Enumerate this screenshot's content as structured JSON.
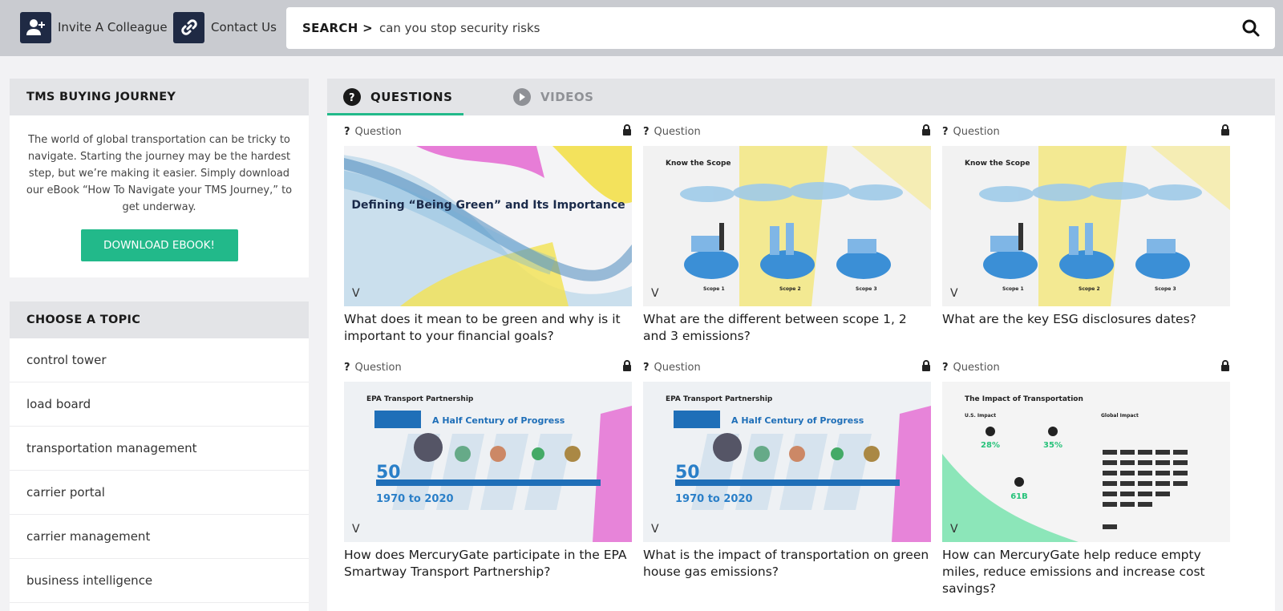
{
  "topbar": {
    "invite_label": "Invite A Colleague",
    "contact_label": "Contact Us",
    "search_prefix": "SEARCH >",
    "search_value": "can you stop security risks"
  },
  "sidebar": {
    "journey": {
      "title": "TMS BUYING JOURNEY",
      "text": "The world of global transportation can be tricky to navigate. Starting the journey may be the hardest step, but we’re making it easier. Simply download our eBook “How To Navigate your TMS Journey,” to get underway.",
      "button": "DOWNLOAD EBOOK!"
    },
    "topics_title": "CHOOSE A TOPIC",
    "topics": [
      "control tower",
      "load board",
      "transportation management",
      "carrier portal",
      "carrier management",
      "business intelligence"
    ]
  },
  "tabs": [
    {
      "label": "QUESTIONS",
      "active": true
    },
    {
      "label": "VIDEOS",
      "active": false
    }
  ],
  "colors": {
    "accent": "#22b98a",
    "navy": "#1f2a44"
  },
  "cards": [
    {
      "tag": "Question",
      "thumb": "green",
      "title": "What does it mean to be green and why is it important to your financial goals?",
      "thumb_text": "Defining “Being Green” and Its Importance"
    },
    {
      "tag": "Question",
      "thumb": "scope",
      "title": "What are the different between scope 1, 2 and 3 emissions?",
      "thumb_text": "Know the Scope",
      "scope_labels": [
        "Scope 1",
        "Scope 2",
        "Scope 3"
      ]
    },
    {
      "tag": "Question",
      "thumb": "scope",
      "title": "What are the key ESG disclosures dates?",
      "thumb_text": "Know the Scope",
      "scope_labels": [
        "Scope 1",
        "Scope 2",
        "Scope 3"
      ]
    },
    {
      "tag": "Question",
      "thumb": "epa",
      "title": "How does MercuryGate participate in the EPA Smartway Transport Partnership?",
      "thumb_text": "EPA Transport Partnership",
      "thumb_sub": "A Half Century of Progress",
      "years": "1970 to 2020"
    },
    {
      "tag": "Question",
      "thumb": "epa",
      "title": "What is the impact of transportation on green house gas emissions?",
      "thumb_text": "EPA Transport Partnership",
      "thumb_sub": "A Half Century of Progress",
      "years": "1970 to 2020"
    },
    {
      "tag": "Question",
      "thumb": "impact",
      "title": "How can MercuryGate help reduce empty miles, reduce emissions and increase cost savings?",
      "thumb_text": "The Impact of Transportation",
      "stats": [
        "28%",
        "35%",
        "61B"
      ],
      "headers": [
        "U.S. Impact",
        "Global Impact"
      ]
    }
  ]
}
